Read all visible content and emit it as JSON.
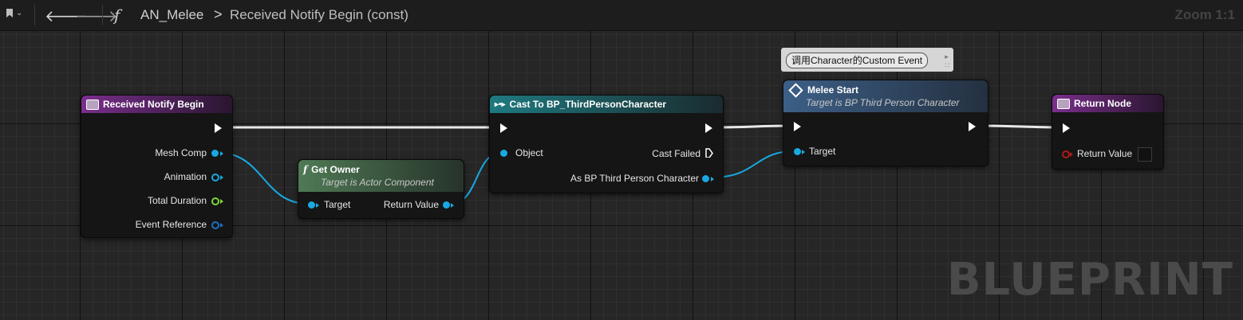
{
  "toolbar": {
    "bookmark_icon": "bookmark-icon",
    "back_icon": "arrow-left-icon",
    "forward_icon": "arrow-right-icon",
    "function_icon": "f",
    "breadcrumb_root": "AN_Melee",
    "breadcrumb_sep": ">",
    "breadcrumb_current": "Received Notify Begin (const)",
    "zoom": "Zoom 1:1"
  },
  "watermark": "BLUEPRINT",
  "comment": {
    "text": "调用Character的Custom Event"
  },
  "nodes": {
    "received_notify_begin": {
      "title": "Received Notify Begin",
      "pins": [
        "Mesh Comp",
        "Animation",
        "Total Duration",
        "Event Reference"
      ]
    },
    "get_owner": {
      "title": "Get Owner",
      "subtitle": "Target is Actor Component",
      "icon": "f",
      "input": "Target",
      "output": "Return Value"
    },
    "cast": {
      "title": "Cast To BP_ThirdPersonCharacter",
      "input": "Object",
      "cast_failed": "Cast Failed",
      "output": "As BP Third Person Character"
    },
    "melee_start": {
      "title": "Melee Start",
      "subtitle": "Target is BP Third Person Character",
      "input": "Target"
    },
    "return_node": {
      "title": "Return Node",
      "input": "Return Value"
    }
  },
  "colors": {
    "exec": "#ffffff",
    "object_pin": "#19a8e0",
    "float_pin": "#7fd63a",
    "bool_pin": "#b01818",
    "function_header": "#7a2e8c",
    "cast_header": "#1e7a80",
    "pure_header": "#4f7a55",
    "event_call_header": "#3c5f86"
  }
}
